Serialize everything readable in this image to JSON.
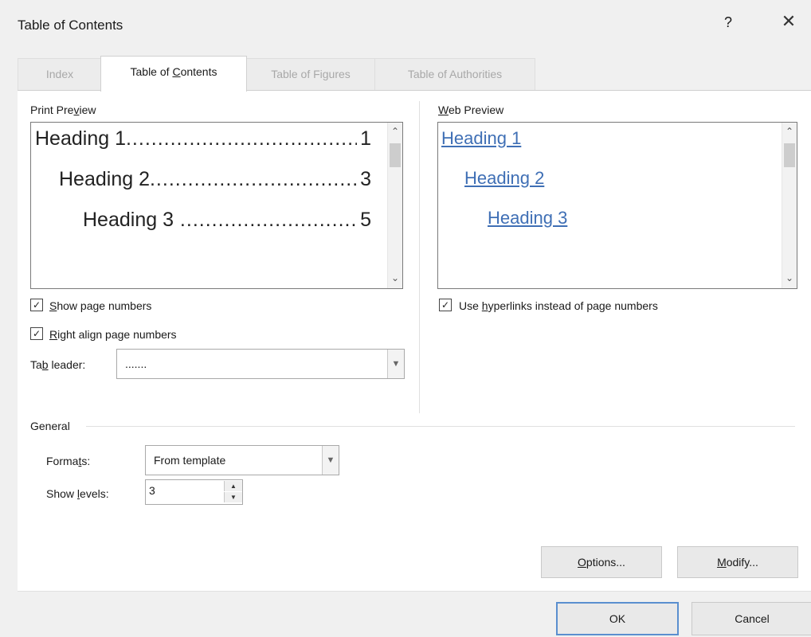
{
  "window": {
    "title": "Table of Contents",
    "help_label": "?",
    "close_label": "✕"
  },
  "tabs": [
    {
      "label": "Index",
      "active": false
    },
    {
      "label": "Table of Contents",
      "active": true
    },
    {
      "label": "Table of Figures",
      "active": false
    },
    {
      "label": "Table of Authorities",
      "active": false
    }
  ],
  "print_preview": {
    "label_pre": "Print Pre",
    "label_key": "v",
    "label_post": "iew",
    "entries": [
      {
        "heading": "Heading 1",
        "page": "1"
      },
      {
        "heading": "Heading 2",
        "page": "3"
      },
      {
        "heading": "Heading 3",
        "page": "5"
      }
    ]
  },
  "web_preview": {
    "label_key": "W",
    "label_post": "eb Preview",
    "links": [
      "Heading 1",
      "Heading 2",
      "Heading 3"
    ]
  },
  "options": {
    "show_page_numbers": {
      "key": "S",
      "rest": "how page numbers",
      "checked": true
    },
    "right_align": {
      "key": "R",
      "rest": "ight align page numbers",
      "checked": true
    },
    "tab_leader": {
      "pre": "Ta",
      "key": "b",
      "post": " leader:",
      "value": "......."
    },
    "use_hyperlinks": {
      "pre": "Use ",
      "key": "h",
      "rest": "yperlinks instead of page numbers",
      "checked": true
    }
  },
  "general": {
    "label": "General",
    "formats": {
      "pre": "Forma",
      "key": "t",
      "post": "s:",
      "value": "From template"
    },
    "show_levels": {
      "pre": "Show ",
      "key": "l",
      "post": "evels:",
      "value": "3"
    }
  },
  "buttons": {
    "options": {
      "key": "O",
      "rest": "ptions..."
    },
    "modify": {
      "key": "M",
      "rest": "odify..."
    },
    "ok": "OK",
    "cancel": "Cancel"
  },
  "icons": {
    "check": "check-icon",
    "chevron_down": "chevron-down-icon",
    "scroll_up": "scroll-up-arrow-icon",
    "scroll_down": "scroll-down-arrow-icon"
  },
  "colors": {
    "link": "#3f6fb5",
    "default_button_border": "#5a8fcf"
  }
}
